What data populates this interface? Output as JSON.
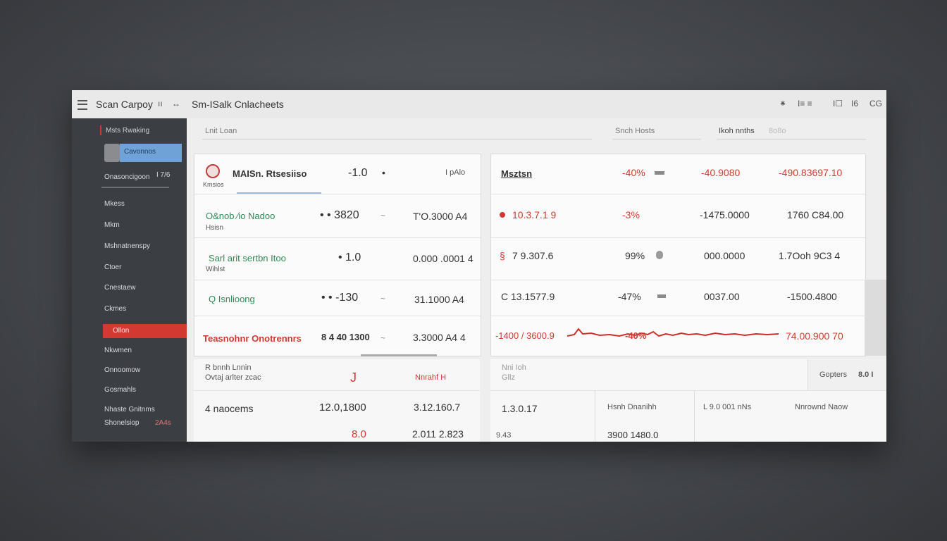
{
  "titlebar": {
    "app_name": "Scan Carpoy",
    "pause_glyph": "ıı",
    "arrow_glyph": "↔",
    "title": "Sm-ISalk Cnlacheets",
    "right_icons": [
      "star-icon",
      "grid-icon",
      "window-icon",
      "c-icon"
    ],
    "right_labels": [
      "⁕",
      "I≡ ≡",
      "I☐",
      "I6",
      "CG"
    ]
  },
  "sidebar": {
    "header": "Msts Rwaking",
    "selected_item": "Cavonnos",
    "row3_label": "Onasoncigoon",
    "row3_value": "I 7/6",
    "items": [
      "Mkess",
      "Mkm",
      "Mshnatnenspy",
      "Ctoer",
      "Cnestaew",
      "Ckmes"
    ],
    "active_red_item": "Ollon",
    "items_after": [
      "Nkwmen",
      "Onnoomow",
      "Gosmahls"
    ],
    "footer_line1": "Nhaste Gnitnms",
    "footer_line2": "Shonelsiop",
    "footer_value": "2A4s"
  },
  "toolbar": {
    "search_placeholder": "Lnit Loan",
    "mid_label": "Snch Hosts",
    "right_label": "Ikoh nnths",
    "right_value": "8o8o"
  },
  "left_table": {
    "rows": [
      {
        "name": "MAISn. Rtsesiiso",
        "sub": "Kmsios",
        "c1": "-1.0",
        "c2": "•",
        "c3": "I pAlo"
      },
      {
        "name": "O&nob ⁄io Nadoo",
        "sub": "Hsisn",
        "c1": "• • 3820",
        "c2": "~",
        "c3": "T'O.3000 A4"
      },
      {
        "name": "Sarl arit sertbn Itoo",
        "sub": "Wihlst",
        "c1": "• 1.0",
        "c2": "",
        "c3": "0.000 .0001 4"
      },
      {
        "name": "Q Isnlioong",
        "sub": "",
        "c1": "• • -130",
        "c2": "~",
        "c3": "31.1000 A4"
      },
      {
        "name": "Teasnohnr Onotrennrs",
        "sub": "",
        "c1": "8 4 40 1300",
        "c2": "~",
        "c3": "3.3000 A4 4"
      }
    ]
  },
  "right_table": {
    "header": {
      "name": "Msztsn",
      "c1": "-40%",
      "c2": "-40.9080",
      "c3": "-490.83697.10"
    },
    "rows": [
      {
        "c0": "10.3.7.1 9",
        "c1": "-3%",
        "c2": "-1475.0000",
        "c3": "1760 C84.00"
      },
      {
        "c0": "7 9.307.6",
        "c1": "99% ",
        "c2": "000.0000",
        "c3": "1.7Ooh 9C3 4"
      },
      {
        "c0": "C 13.1577.9",
        "c1": "-47%",
        "c2": "0037.00",
        "c3": "-1500.4800"
      },
      {
        "c0": "-1400 / 3600.9",
        "c1": "-40%",
        "c2": "",
        "c3": "74.00.900 70"
      }
    ]
  },
  "bottom": {
    "left_label1": "R bnnh Lnnin",
    "left_label2": "Ovtaj arlter zcac",
    "left_mark": "J",
    "left_red_label": "Nnrahf H",
    "mid_label1": "Nni Ioh",
    "mid_label2": "Gllz",
    "right_label": "Gopters",
    "right_value": "8.0 I",
    "row1": {
      "name": "4 naocems",
      "c1": "12.0,1800",
      "c2": "3.12.160.7",
      "c3": "1.3.0.17",
      "c4": "Hsnh Dnanihh",
      "c5": "L 9.0 001 nNs",
      "c6": "Nnrownd Naow"
    },
    "row2": {
      "c1": "8.0",
      "c2": "2.011 2.823",
      "c3": "9.43",
      "c4": "3900 1480.0"
    }
  },
  "colors": {
    "sidebar_bg": "#3b3e43",
    "accent_red": "#d23a31",
    "selection_blue": "#6fa3d8",
    "chart_red": "#cc2f2a"
  }
}
